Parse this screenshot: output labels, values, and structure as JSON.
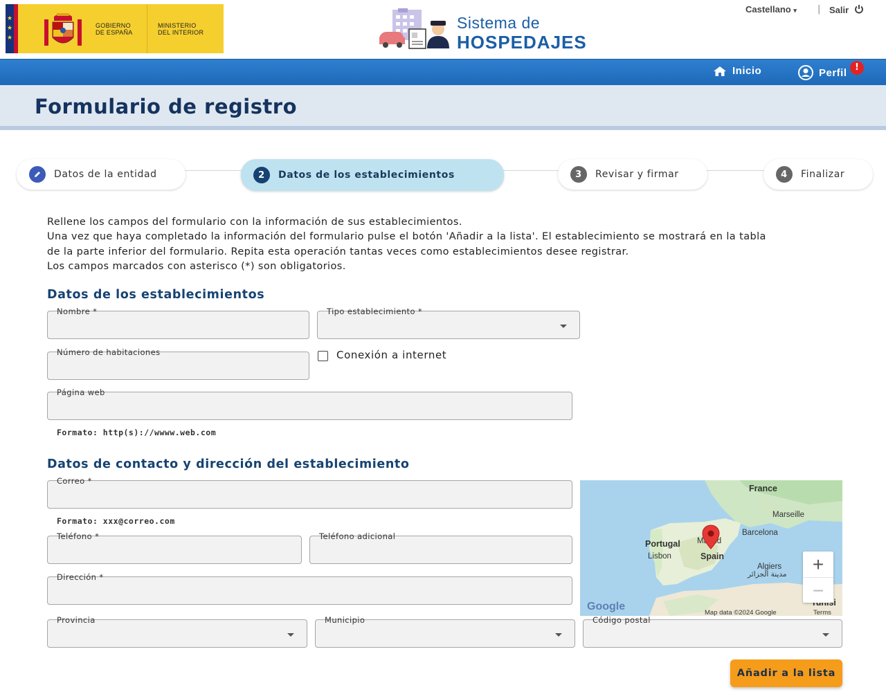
{
  "header": {
    "gov_line1": "GOBIERNO",
    "gov_line2": "DE ESPAÑA",
    "ministry_line1": "MINISTERIO",
    "ministry_line2": "DEL INTERIOR",
    "brand_line1": "Sistema de",
    "brand_line2": "HOSPEDAJES",
    "language": "Castellano",
    "separator": "|",
    "logout": "Salir"
  },
  "nav": {
    "home": "Inicio",
    "profile": "Perfil",
    "profile_badge": "!"
  },
  "page_title": "Formulario de registro",
  "steps": [
    {
      "number": "",
      "label": "Datos de la entidad",
      "state": "done"
    },
    {
      "number": "2",
      "label": "Datos de los establecimientos",
      "state": "active"
    },
    {
      "number": "3",
      "label": "Revisar y firmar",
      "state": "pending"
    },
    {
      "number": "4",
      "label": "Finalizar",
      "state": "pending"
    }
  ],
  "intro": [
    "Rellene los campos del formulario con la información de sus establecimientos.",
    "Una vez que haya completado la información del formulario pulse el botón 'Añadir a la lista'. El establecimiento se mostrará en la tabla",
    "de la parte inferior del formulario. Repita esta operación tantas veces como establecimientos desee registrar.",
    "Los campos marcados con asterisco (*) son obligatorios."
  ],
  "establishment": {
    "section_title": "Datos de los establecimientos",
    "name_label": "Nombre *",
    "type_label": "Tipo establecimiento *",
    "rooms_label": "Número de habitaciones",
    "internet_label": "Conexión a internet",
    "internet_checked": false,
    "web_label": "Página web",
    "web_hint": "Formato: http(s)://wwww.web.com"
  },
  "contact": {
    "section_title": "Datos de contacto y dirección del establecimiento",
    "email_label": "Correo *",
    "email_hint": "Formato: xxx@correo.com",
    "phone_label": "Teléfono *",
    "phone2_label": "Teléfono adicional",
    "address_label": "Dirección *",
    "province_label": "Provincia",
    "municipality_label": "Municipio",
    "postal_label": "Código postal"
  },
  "map": {
    "labels": {
      "france": "France",
      "marseille": "Marseille",
      "barcelona": "Barcelona",
      "portugal": "Portugal",
      "lisbon": "Lisbon",
      "madrid": "Madrid",
      "spain": "Spain",
      "algiers": "Algiers",
      "algiers_ar": "مدينة الجزائر",
      "tunisia": "Tunisi",
      "google": "Google",
      "map_data": "Map data ©2024 Google",
      "terms": "Terms"
    },
    "zoom_in": "+",
    "zoom_out": "−"
  },
  "add_button": "Añadir a la lista"
}
